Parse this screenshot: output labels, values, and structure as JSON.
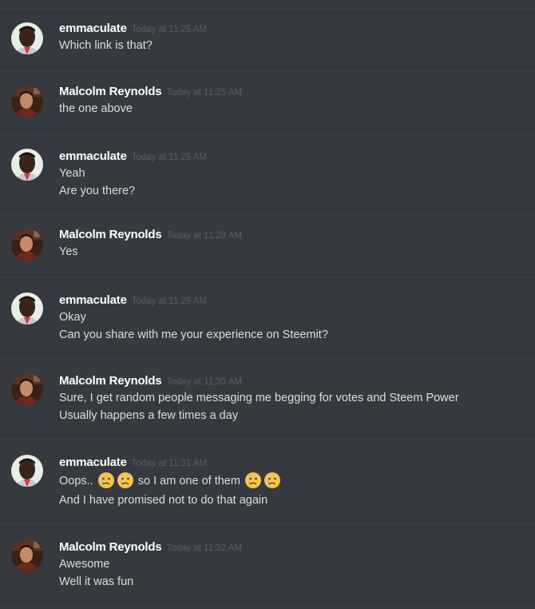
{
  "messages": [
    {
      "author": "emmaculate",
      "avatar": "emmaculate-avatar",
      "time": "Today at 11:25 AM",
      "lines": [
        "Which link is that?"
      ]
    },
    {
      "author": "Malcolm Reynolds",
      "avatar": "malcolm-avatar",
      "time": "Today at 11:25 AM",
      "lines": [
        "the one above"
      ]
    },
    {
      "author": "emmaculate",
      "avatar": "emmaculate-avatar",
      "time": "Today at 11:25 AM",
      "lines": [
        "Yeah",
        "Are you there?"
      ]
    },
    {
      "author": "Malcolm Reynolds",
      "avatar": "malcolm-avatar",
      "time": "Today at 11:28 AM",
      "lines": [
        "Yes"
      ]
    },
    {
      "author": "emmaculate",
      "avatar": "emmaculate-avatar",
      "time": "Today at 11:29 AM",
      "lines": [
        "Okay",
        "Can you share with me your experience on Steemit?"
      ]
    },
    {
      "author": "Malcolm Reynolds",
      "avatar": "malcolm-avatar",
      "time": "Today at 11:30 AM",
      "lines": [
        "Sure, I get random people messaging me begging for votes and Steem Power",
        "Usually happens a few times a day"
      ]
    },
    {
      "author": "emmaculate",
      "avatar": "emmaculate-avatar",
      "time": "Today at 11:31 AM",
      "emoji_line": {
        "text_1": "Oops..",
        "text_2": "so I am one of them",
        "emoji": "crying-face-emoji"
      },
      "lines": [
        "And I have promised not to do that again"
      ]
    },
    {
      "author": "Malcolm Reynolds",
      "avatar": "malcolm-avatar",
      "time": "Today at 11:32 AM",
      "lines": [
        "Awesome",
        "Well it was fun"
      ]
    }
  ],
  "colors": {
    "background": "#36393f",
    "divider": "#3f4248",
    "username": "#ffffff",
    "timestamp": "#5b5e64",
    "text": "#dcddde"
  }
}
